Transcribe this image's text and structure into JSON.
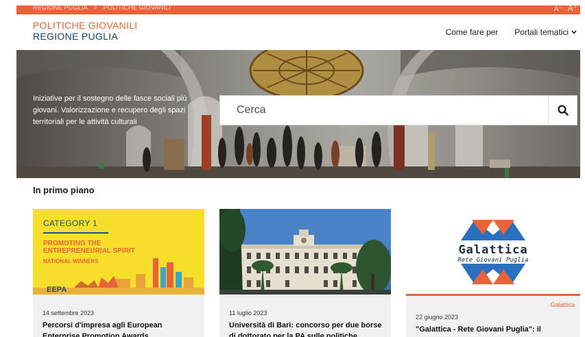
{
  "topbar": {
    "breadcrumb": [
      "REGIONE PUGLIA",
      ">",
      "POLITICHE GIOVANILI"
    ],
    "font_small": "A⁻",
    "font_large": "A⁺",
    "color": "#e8623a"
  },
  "brand": {
    "line1": "POLITICHE GIOVANILI",
    "line2": "REGIONE PUGLIA"
  },
  "nav": {
    "items": [
      {
        "label": "Come fare per"
      },
      {
        "label": "Portali tematici"
      }
    ]
  },
  "hero": {
    "tagline": "Iniziative per il sostegno delle fasce sociali più giovani. Valorizzazione e recupero degli spazi territoriali per le attività culturali",
    "search_placeholder": "Cerca",
    "search_icon": "search-icon"
  },
  "section": {
    "title": "In primo piano"
  },
  "cards": [
    {
      "image": {
        "category": "CATEGORY 1",
        "promo_line1": "PROMOTING THE",
        "promo_line2": "ENTREPRENEURIAL SPIRIT",
        "winners": "NATIONAL WINNERS",
        "logo": "EEPA"
      },
      "date": "14 settembre 2023",
      "title": "Percorsi d'impresa agli European Enterprise Promotion Awards"
    },
    {
      "date": "11 luglio 2023",
      "title": "Università di Bari: concorso per due borse di dottorato per la PA sulle politiche giovanili"
    },
    {
      "category": "Galattica",
      "image": {
        "logo_title": "Galattica",
        "logo_subtitle": "Rete Giovani Puglia"
      },
      "date": "22 giugno 2023",
      "title": "\"Galattica - Rete Giovani Puglia\": il Calendario"
    }
  ]
}
